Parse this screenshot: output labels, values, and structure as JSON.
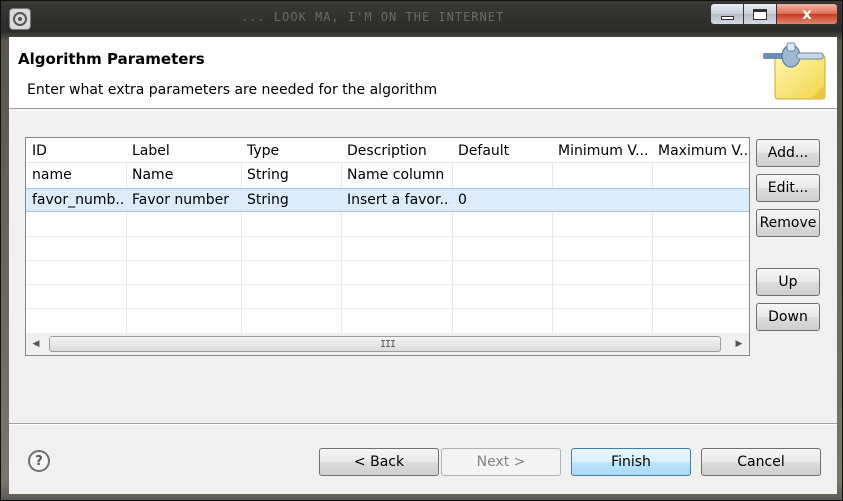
{
  "window": {
    "title": "... LOOK MA, I'M ON THE INTERNET",
    "buttons": {
      "minimize": "minimize",
      "maximize": "maximize",
      "close": "x"
    }
  },
  "header": {
    "title": "Algorithm Parameters",
    "description": "Enter what extra parameters are needed for the algorithm"
  },
  "table": {
    "columns": [
      "ID",
      "Label",
      "Type",
      "Description",
      "Default",
      "Minimum V...",
      "Maximum V..."
    ],
    "rows": [
      {
        "id": "name",
        "label": "Name",
        "type": "String",
        "description": "Name column",
        "default": "",
        "min": "",
        "max": "",
        "selected": false
      },
      {
        "id": "favor_numb...",
        "label": "Favor number",
        "type": "String",
        "description": "Insert a favor...",
        "default": "0",
        "min": "",
        "max": "",
        "selected": true
      }
    ],
    "scroll_grip": "III",
    "scroll_left": "◀",
    "scroll_right": "▶"
  },
  "side_buttons": {
    "add": "Add...",
    "edit": "Edit...",
    "remove": "Remove",
    "up": "Up",
    "down": "Down"
  },
  "footer": {
    "help": "?",
    "back": "< Back",
    "next": "Next >",
    "finish": "Finish",
    "cancel": "Cancel"
  },
  "colors": {
    "selection": "#ddecfb",
    "default_button_border": "#3c7fb1"
  }
}
